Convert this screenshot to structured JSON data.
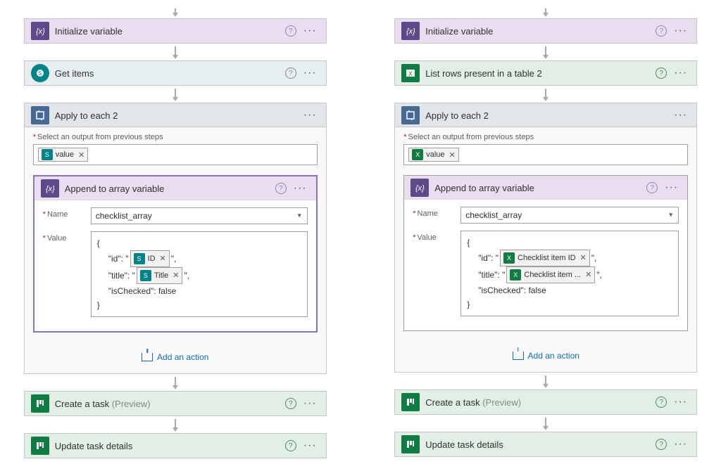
{
  "left": {
    "initVar": {
      "title": "Initialize variable"
    },
    "source": {
      "title": "Get items"
    },
    "loop": {
      "title": "Apply to each 2",
      "prevStepsLabel": "Select an output from previous steps",
      "token": "value"
    },
    "append": {
      "title": "Append to array variable",
      "nameLabel": "Name",
      "valueLabel": "Value",
      "nameValue": "checklist_array",
      "json": {
        "open": "{",
        "idKey": "\"id\": \"",
        "idToken": "ID",
        "sep": "\",",
        "titleKey": "\"title\": \"",
        "titleToken": "Title",
        "isChecked": "\"isChecked\": false",
        "close": "}"
      }
    },
    "addAction": "Add an action",
    "createTask": {
      "title": "Create a task",
      "suffix": "(Preview)"
    },
    "updateTask": {
      "title": "Update task details"
    }
  },
  "right": {
    "initVar": {
      "title": "Initialize variable"
    },
    "source": {
      "title": "List rows present in a table 2"
    },
    "loop": {
      "title": "Apply to each 2",
      "prevStepsLabel": "Select an output from previous steps",
      "token": "value"
    },
    "append": {
      "title": "Append to array variable",
      "nameLabel": "Name",
      "valueLabel": "Value",
      "nameValue": "checklist_array",
      "json": {
        "open": "{",
        "idKey": "\"id\": \"",
        "idToken": "Checklist item ID",
        "sep": "\",",
        "titleKey": "\"title\": \"",
        "titleToken": "Checklist item ...",
        "isChecked": "\"isChecked\": false",
        "close": "}"
      }
    },
    "addAction": "Add an action",
    "createTask": {
      "title": "Create a task",
      "suffix": "(Preview)"
    },
    "updateTask": {
      "title": "Update task details"
    }
  }
}
